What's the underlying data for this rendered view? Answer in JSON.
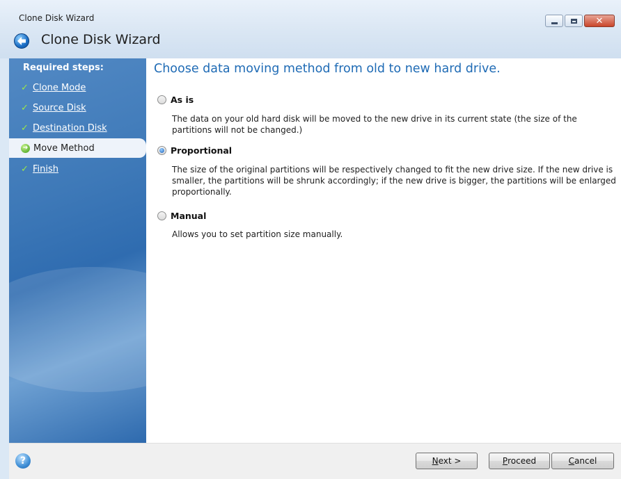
{
  "window": {
    "title": "Clone Disk Wizard",
    "header_title": "Clone Disk Wizard",
    "close_glyph": "✕"
  },
  "sidebar": {
    "section_label": "Required steps:",
    "steps": [
      {
        "label": "Clone Mode",
        "state": "done"
      },
      {
        "label": "Source Disk",
        "state": "done"
      },
      {
        "label": "Destination Disk",
        "state": "done"
      },
      {
        "label": "Move Method",
        "state": "current"
      },
      {
        "label": "Finish",
        "state": "done"
      }
    ]
  },
  "main": {
    "heading": "Choose data moving method from old to new hard drive.",
    "selected_option": "Proportional",
    "options": [
      {
        "label": "As is",
        "description": "The data on your old hard disk will be moved to the new drive in its current state (the size of the partitions will not be changed.)"
      },
      {
        "label": "Proportional",
        "description": "The size of the original partitions will be respectively changed to fit the new drive size. If the new drive is smaller, the partitions will be shrunk accordingly; if the new drive is bigger, the partitions will be enlarged proportionally."
      },
      {
        "label": "Manual",
        "description": "Allows you to set partition size manually."
      }
    ]
  },
  "footer": {
    "help_glyph": "?",
    "next": {
      "mnemonic": "N",
      "rest": "ext >"
    },
    "proceed": {
      "mnemonic": "P",
      "rest": "roceed"
    },
    "cancel": {
      "mnemonic": "C",
      "rest": "ancel"
    }
  },
  "colors": {
    "accent": "#1f6bb5",
    "sidebar": "#3e79b8",
    "check": "#9be64a"
  },
  "icons": [
    "back-arrow-icon",
    "minimize-icon",
    "maximize-icon",
    "close-icon",
    "checkmark-icon",
    "current-step-arrow-icon",
    "help-icon"
  ]
}
